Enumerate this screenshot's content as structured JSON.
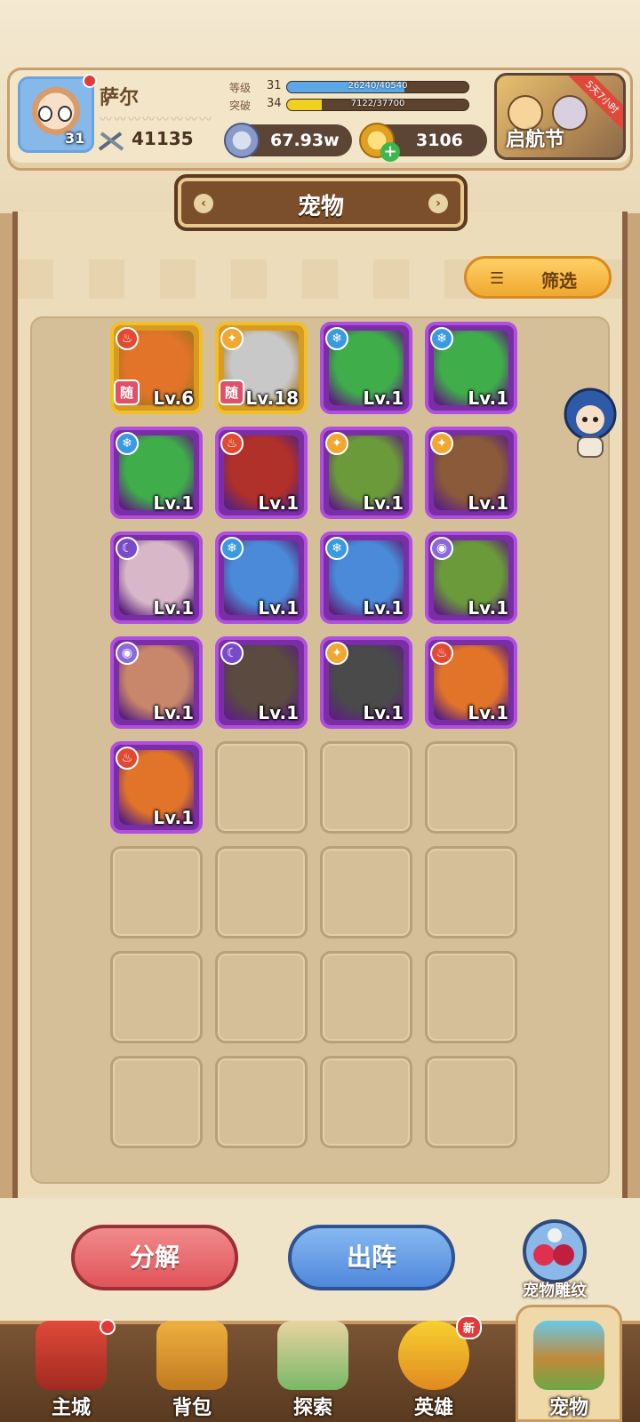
{
  "player": {
    "name": "萨尔",
    "level_badge": "31",
    "avatar_tag": "YoYoUp",
    "power": "41135",
    "level_label": "等级",
    "level_value": "31",
    "level_progress": "26240/40540",
    "level_fraction": 0.647,
    "break_label": "突破",
    "break_value": "34",
    "break_progress": "7122/37700",
    "break_fraction": 0.189
  },
  "currency": {
    "silver": "67.93w",
    "gold": "3106"
  },
  "event": {
    "label": "启航节",
    "timer": "5天7小时"
  },
  "page": {
    "title": "宠物",
    "filter_label": "筛选"
  },
  "pets": [
    {
      "level": "Lv.6",
      "element": "fire",
      "frame": "gold",
      "tag": "随",
      "color": "#e2742a"
    },
    {
      "level": "Lv.18",
      "element": "light",
      "frame": "gold",
      "tag": "随",
      "color": "#c8c8c8"
    },
    {
      "level": "Lv.1",
      "element": "ice",
      "frame": "purple",
      "tag": "",
      "color": "#3fae4a"
    },
    {
      "level": "Lv.1",
      "element": "ice",
      "frame": "purple",
      "tag": "",
      "color": "#3fae4a"
    },
    {
      "level": "Lv.1",
      "element": "ice",
      "frame": "purple",
      "tag": "",
      "color": "#3fae4a"
    },
    {
      "level": "Lv.1",
      "element": "fire",
      "frame": "purple",
      "tag": "",
      "color": "#b0302a"
    },
    {
      "level": "Lv.1",
      "element": "light",
      "frame": "purple",
      "tag": "",
      "color": "#6a9a3a"
    },
    {
      "level": "Lv.1",
      "element": "light",
      "frame": "purple",
      "tag": "",
      "color": "#8a5a3a"
    },
    {
      "level": "Lv.1",
      "element": "moon",
      "frame": "purple",
      "tag": "",
      "color": "#d8b8c8"
    },
    {
      "level": "Lv.1",
      "element": "ice",
      "frame": "purple",
      "tag": "",
      "color": "#4a8ad8"
    },
    {
      "level": "Lv.1",
      "element": "ice",
      "frame": "purple",
      "tag": "",
      "color": "#4a8ad8"
    },
    {
      "level": "Lv.1",
      "element": "eye",
      "frame": "purple",
      "tag": "",
      "color": "#6a9a3a"
    },
    {
      "level": "Lv.1",
      "element": "eye",
      "frame": "purple",
      "tag": "",
      "color": "#c8866a"
    },
    {
      "level": "Lv.1",
      "element": "moon",
      "frame": "purple",
      "tag": "",
      "color": "#5a4a40"
    },
    {
      "level": "Lv.1",
      "element": "light",
      "frame": "purple",
      "tag": "",
      "color": "#4a4a4a"
    },
    {
      "level": "Lv.1",
      "element": "fire",
      "frame": "purple",
      "tag": "",
      "color": "#e2742a"
    },
    {
      "level": "Lv.1",
      "element": "fire",
      "frame": "purple",
      "tag": "",
      "color": "#e2742a"
    }
  ],
  "actions": {
    "decompose": "分解",
    "deploy": "出阵",
    "engrave": "宠物雕纹"
  },
  "nav": {
    "city": "主城",
    "bag": "背包",
    "explore": "探索",
    "hero": "英雄",
    "hero_badge": "新",
    "pet": "宠物"
  }
}
